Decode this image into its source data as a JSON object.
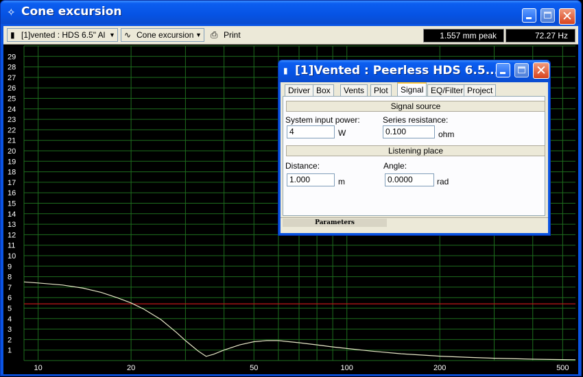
{
  "window": {
    "title": "Cone excursion",
    "app_icon": "✧"
  },
  "toolbar": {
    "project_combo": "[1]vented : HDS 6.5\" Al",
    "plot_combo": "Cone excursion",
    "print_label": "Print",
    "peak_readout": "1.557 mm peak",
    "freq_readout": "72.27 Hz"
  },
  "dialog": {
    "title": "[1]Vented : Peerless HDS 6.5...",
    "tabs": [
      "Driver",
      "Box",
      "Vents",
      "Plot",
      "Signal",
      "EQ/Filter",
      "Project"
    ],
    "active_tab": "Signal",
    "signal_source_header": "Signal source",
    "system_input_power_label": "System input power:",
    "system_input_power_value": "4",
    "system_input_power_unit": "W",
    "series_resistance_label": "Series resistance:",
    "series_resistance_value": "0.100",
    "series_resistance_unit": "ohm",
    "listening_place_header": "Listening place",
    "distance_label": "Distance:",
    "distance_value": "1.000",
    "distance_unit": "m",
    "angle_label": "Angle:",
    "angle_value": "0.0000",
    "angle_unit": "rad",
    "status_text": "Parameters"
  },
  "colors": {
    "grid": "#1e6e1e",
    "curve": "#e8e8c8",
    "peak_line": "#c01818",
    "axis_text": "#ffffff"
  },
  "chart_data": {
    "type": "line",
    "x_scale": "log",
    "xlim": [
      9,
      550
    ],
    "ylim": [
      0,
      30
    ],
    "x_tick_labels": [
      "10",
      "20",
      "50",
      "100",
      "200",
      "500"
    ],
    "x_ticks": [
      10,
      20,
      50,
      100,
      200,
      500
    ],
    "y_tick_labels": [
      "1",
      "2",
      "3",
      "4",
      "5",
      "6",
      "7",
      "8",
      "9",
      "10",
      "11",
      "12",
      "13",
      "14",
      "15",
      "16",
      "17",
      "18",
      "19",
      "20",
      "21",
      "22",
      "23",
      "24",
      "25",
      "26",
      "27",
      "28",
      "29"
    ],
    "reference_line_y": 5.4,
    "series": [
      {
        "x": [
          9,
          10,
          12,
          14,
          16,
          18,
          20,
          22,
          25,
          28,
          30,
          33,
          35,
          37,
          40,
          45,
          50,
          55,
          60,
          70,
          80,
          90,
          100,
          120,
          150,
          200,
          250,
          300,
          400,
          500,
          550
        ],
        "y": [
          7.5,
          7.4,
          7.2,
          6.9,
          6.5,
          6.0,
          5.5,
          4.9,
          3.9,
          2.7,
          1.9,
          0.9,
          0.4,
          0.6,
          1.0,
          1.5,
          1.8,
          1.9,
          1.9,
          1.7,
          1.5,
          1.3,
          1.15,
          0.9,
          0.65,
          0.42,
          0.3,
          0.22,
          0.13,
          0.09,
          0.08
        ]
      }
    ]
  }
}
